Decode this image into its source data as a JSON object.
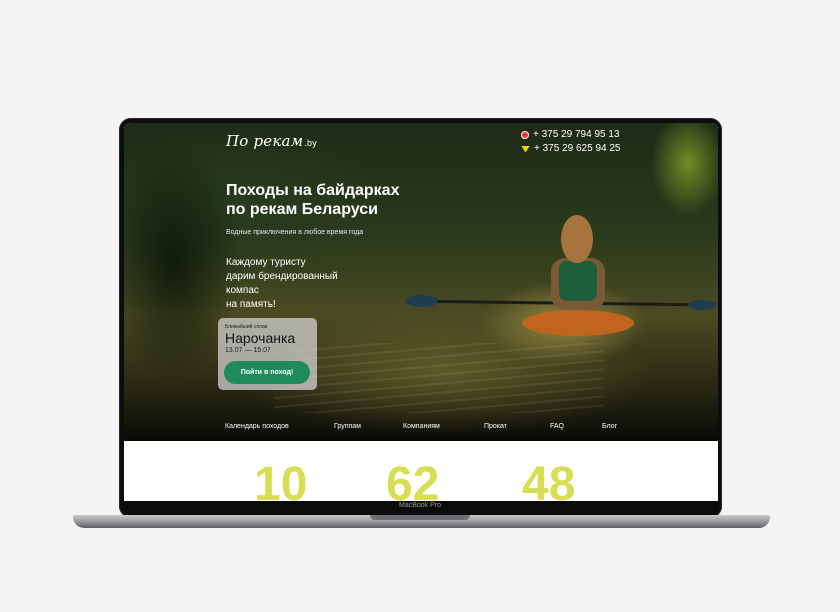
{
  "site": {
    "logo_main": "По рекам",
    "logo_tld": ".by"
  },
  "contacts": {
    "phones": [
      {
        "number": "+ 375 29 794 95 13",
        "icon": "a1-operator-icon"
      },
      {
        "number": "+ 375 29 625 94 25",
        "icon": "life-operator-icon"
      }
    ]
  },
  "hero": {
    "title_line1": "Походы на байдарках",
    "title_line2": "по рекам Беларуси",
    "subtitle": "Водные приключения в любое время года",
    "promo_line1": "Каждому туристу",
    "promo_line2": "дарим брендированный компас",
    "promo_line3": "на память!"
  },
  "next_trip": {
    "label": "Ближайший сплав",
    "name": "Нарочанка",
    "dates": "13.07 — 15.07",
    "button_label": "Пойти в поход!"
  },
  "nav": {
    "items": [
      "Календарь походов",
      "Группам",
      "Компаниям",
      "Прокат",
      "FAQ",
      "Блог"
    ]
  },
  "stats": {
    "values": [
      "10",
      "62",
      "48"
    ]
  },
  "device": {
    "model_label": "MacBook Pro"
  },
  "colors": {
    "accent_green": "#1f8a5b",
    "stat_yellow": "#d7de54"
  }
}
